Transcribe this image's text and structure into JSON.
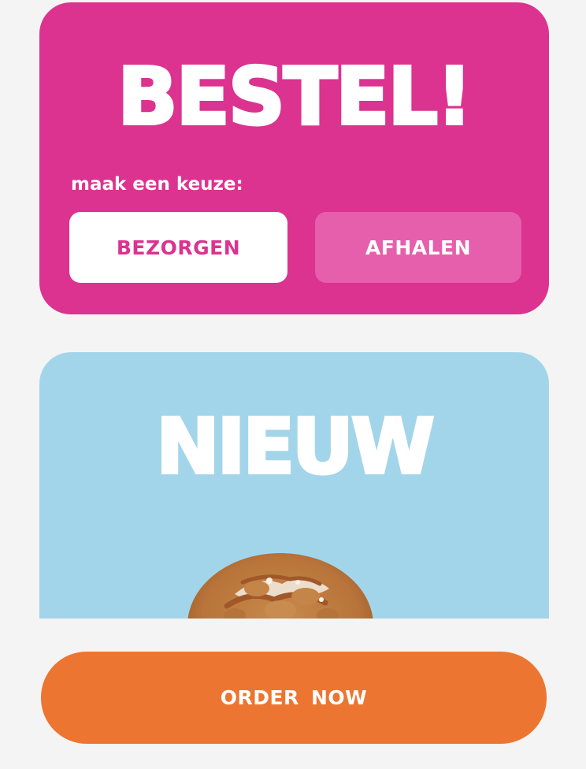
{
  "order_card": {
    "title": "BESTEL!",
    "choice_label": "maak een keuze:",
    "delivery_button": "BEZORGEN",
    "pickup_button": "AFHALEN"
  },
  "new_card": {
    "title": "NIEUW"
  },
  "order_now_button": "ORDER NOW",
  "colors": {
    "pink": "#dc3290",
    "light_pink": "#e55fac",
    "sky_blue": "#a3d5ea",
    "orange": "#ed7532",
    "background": "#f4f4f4"
  }
}
